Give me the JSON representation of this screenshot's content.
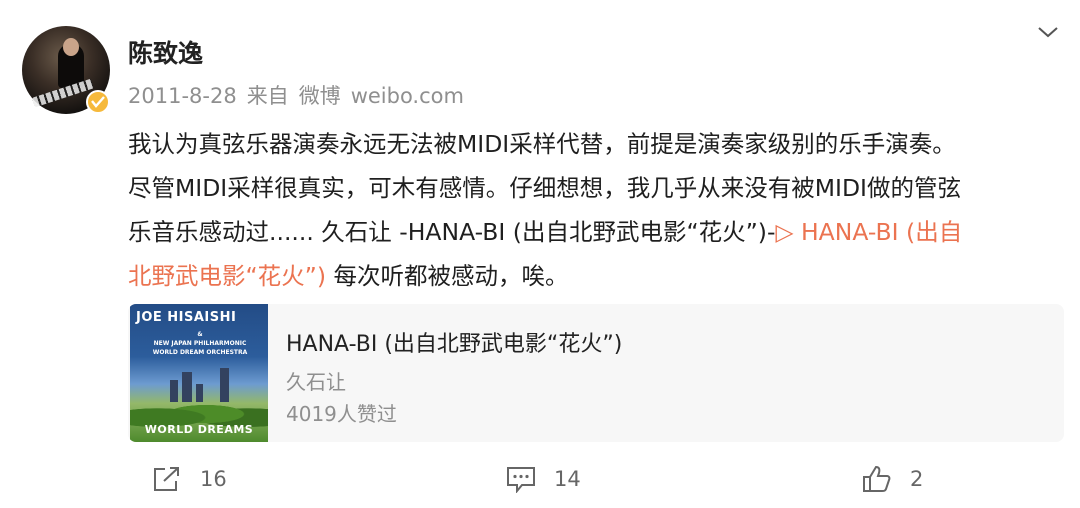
{
  "post": {
    "author": "陈致逸",
    "date": "2011-8-28",
    "source_prefix": "来自",
    "source_app": "微博",
    "source_site": "weibo.com",
    "text_line1": "我认为真弦乐器演奏永远无法被MIDI采样代替，前提是演奏家级别的乐手演奏。",
    "text_line2": "尽管MIDI采样很真实，可木有感情。仔细想想，我几乎从来没有被MIDI做的管弦",
    "text_line3_main": "乐音乐感动过......  久石让 -HANA-BI (出自北野武电影“花火”)-",
    "link_text_a": "▷ HANA-BI (出自",
    "link_text_b": "北野武电影“花火”)",
    "text_line4_tail": " 每次听都被感动，唉。"
  },
  "music_card": {
    "title": "HANA-BI (出自北野武电影“花火”)",
    "artist": "久石让",
    "likes": "4019人赞过",
    "cover_line1": "JOE HISAISHI",
    "cover_line2": "&",
    "cover_line3": "NEW JAPAN PHILHARMONIC",
    "cover_line4": "WORLD DREAM ORCHESTRA",
    "cover_bottom": "WORLD DREAMS"
  },
  "actions": {
    "repost_count": "16",
    "comment_count": "14",
    "like_count": "2"
  },
  "colors": {
    "link": "#eb7350",
    "meta": "#8f8f8f",
    "badge": "#f6b93b"
  }
}
